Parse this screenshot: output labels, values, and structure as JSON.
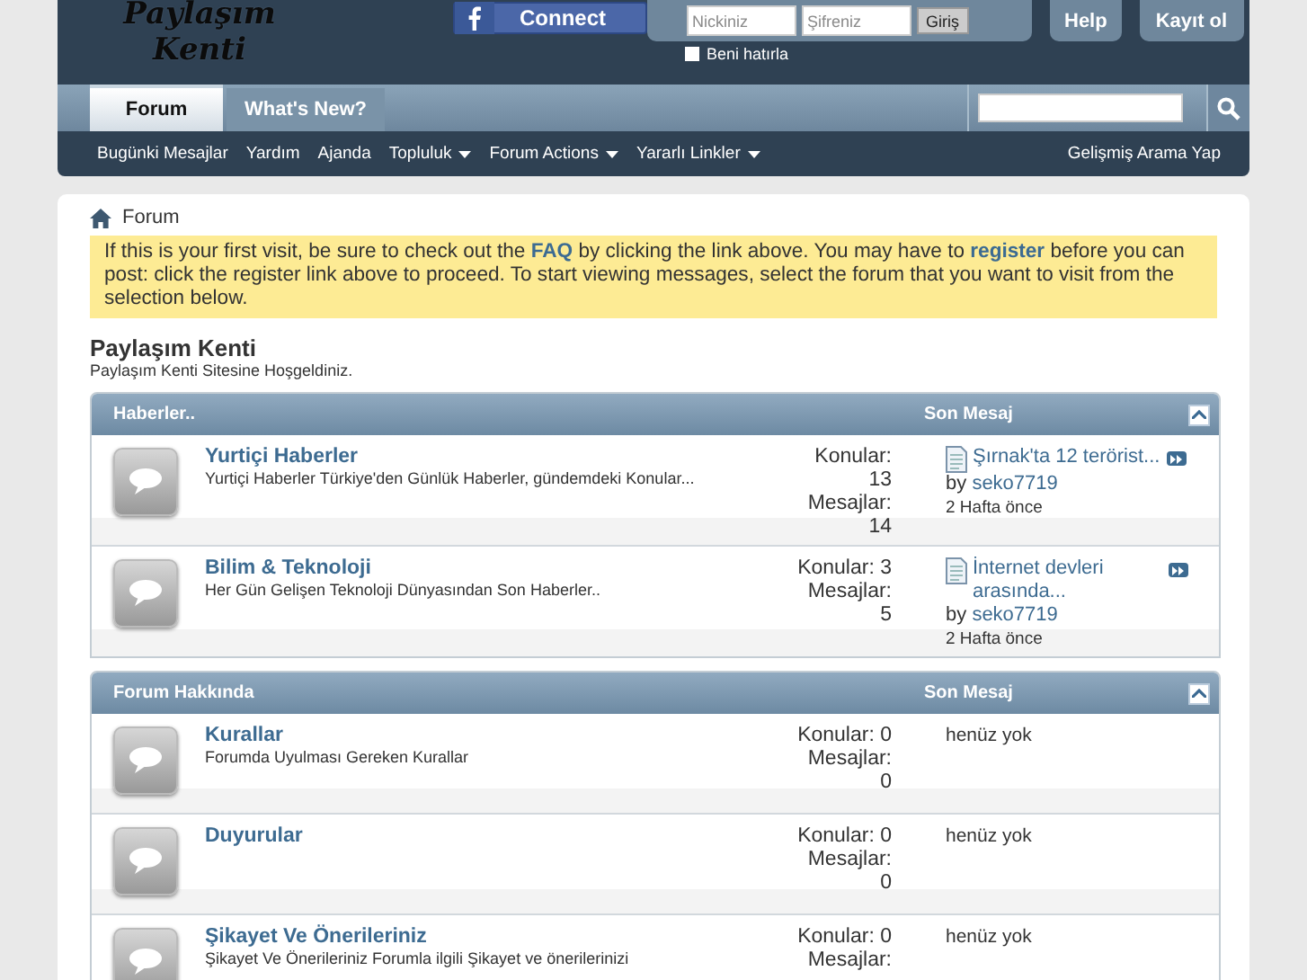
{
  "header": {
    "logo": [
      "Paylaşım",
      "Kenti"
    ],
    "facebook_button": "Connect",
    "login": {
      "username_placeholder": "Nickiniz",
      "password_placeholder": "Şifreniz",
      "submit": "Giriş",
      "remember_label": "Beni hatırla",
      "remember_checked": false
    },
    "buttons": [
      "Help",
      "Kayıt ol"
    ]
  },
  "tabs": [
    {
      "label": "Forum",
      "selected": true
    },
    {
      "label": "What's New?",
      "selected": false
    }
  ],
  "nav_links": [
    {
      "label": "Bugünki Mesajlar",
      "dropdown": false
    },
    {
      "label": "Yardım",
      "dropdown": false
    },
    {
      "label": "Ajanda",
      "dropdown": false
    },
    {
      "label": "Topluluk",
      "dropdown": true
    },
    {
      "label": "Forum Actions",
      "dropdown": true
    },
    {
      "label": "Yararlı Linkler",
      "dropdown": true
    }
  ],
  "nav_right": "Gelişmiş Arama Yap",
  "breadcrumb": "Forum",
  "notice": "If this is your first visit, be sure to check out the **FAQ** by clicking the link above. You may have to **register** before you can post: click the register link above to proceed. To start viewing messages, select the forum that you want to visit from the selection below.",
  "site_title": "Paylaşım Kenti",
  "site_subtitle": "Paylaşım Kenti Sitesine Hoşgeldiniz.",
  "categories": [
    {
      "title": "Haberler..",
      "last_post_heading": "Son Mesaj",
      "forums": [
        {
          "title": "Yurtiçi Haberler",
          "description": "Yurtiçi Haberler Türkiye'den Günlük Haberler, gündemdeki Konular...",
          "stats": [
            {
              "label": "Konular:",
              "value": "13"
            },
            {
              "label": "Mesajlar:",
              "value": "14"
            }
          ],
          "last_post": {
            "title": "Şırnak'ta 12 terörist...",
            "by": "by",
            "author": "seko7719",
            "time": "2 Hafta önce"
          }
        },
        {
          "title": "Bilim & Teknoloji",
          "description": "Her Gün Gelişen Teknoloji Dünyasından Son Haberler..",
          "stats": [
            {
              "label": "Konular:",
              "value": "3"
            },
            {
              "label": "Mesajlar:",
              "value": "5"
            }
          ],
          "last_post": {
            "title": "İnternet devleri arasında...",
            "by": "by",
            "author": "seko7719",
            "time": "2 Hafta önce"
          }
        }
      ]
    },
    {
      "title": "Forum Hakkında",
      "last_post_heading": "Son Mesaj",
      "forums": [
        {
          "title": "Kurallar",
          "description": "Forumda Uyulması Gereken Kurallar",
          "stats": [
            {
              "label": "Konular:",
              "value": "0"
            },
            {
              "label": "Mesajlar:",
              "value": "0"
            }
          ],
          "no_post": "henüz yok"
        },
        {
          "title": "Duyurular",
          "stats": [
            {
              "label": "Konular:",
              "value": "0"
            },
            {
              "label": "Mesajlar:",
              "value": "0"
            }
          ],
          "no_post": "henüz yok"
        },
        {
          "title": "Şikayet Ve Önerileriniz",
          "description": "Şikayet Ve Önerileriniz Forumla ilgili Şikayet ve önerilerinizi",
          "stats": [
            {
              "label": "Konular:",
              "value": "0"
            },
            {
              "label": "Mesajlar:"
            }
          ],
          "no_post": "henüz yok"
        }
      ]
    }
  ]
}
